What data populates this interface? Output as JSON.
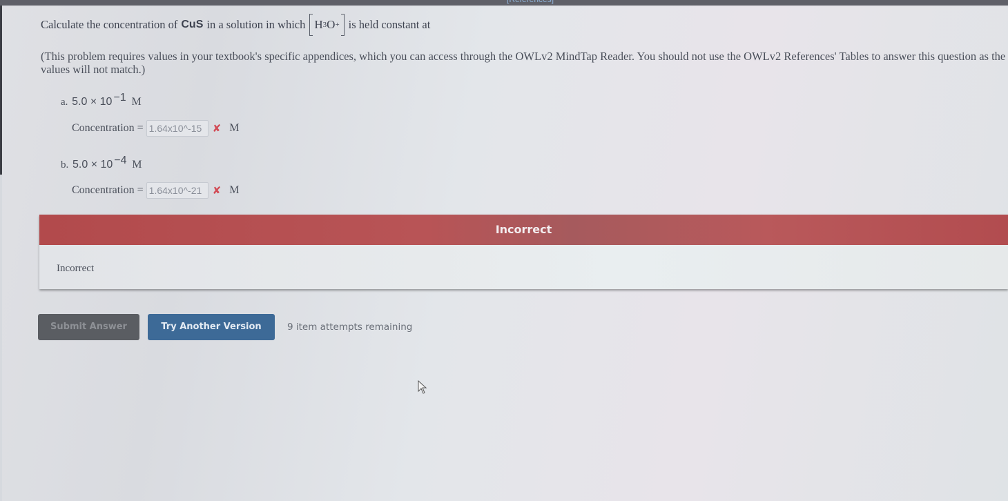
{
  "topbar": {
    "references_label": "[References]"
  },
  "question": {
    "prefix": "Calculate the concentration of",
    "compound": "CuS",
    "middle": "in a solution in which",
    "ion": {
      "base": "H",
      "sub": "3",
      "o": "O",
      "sup": "+"
    },
    "suffix": "is held constant at"
  },
  "note": "(This problem requires values in your textbook's specific appendices, which you can access through the OWLv2 MindTap Reader. You should not use the OWLv2 References' Tables to answer this question as the values will not match.)",
  "parts": [
    {
      "letter": "a.",
      "mantissa": "5.0 × 10",
      "exponent": "−1",
      "unit": "M",
      "concentration_label": "Concentration =",
      "answer_value": "1.64x10^-15",
      "status": "incorrect",
      "answer_unit": "M"
    },
    {
      "letter": "b.",
      "mantissa": "5.0 × 10",
      "exponent": "−4",
      "unit": "M",
      "concentration_label": "Concentration =",
      "answer_value": "1.64x10^-21",
      "status": "incorrect",
      "answer_unit": "M"
    }
  ],
  "feedback": {
    "header": "Incorrect",
    "body": "Incorrect",
    "header_color": "#b24a4c"
  },
  "actions": {
    "submit_label": "Submit Answer",
    "try_another_label": "Try Another Version",
    "attempts_text": "9 item attempts remaining"
  },
  "icons": {
    "wrong_mark": "✘",
    "wrong_icon_name": "x-mark-icon",
    "cursor_icon_name": "mouse-pointer-icon"
  }
}
